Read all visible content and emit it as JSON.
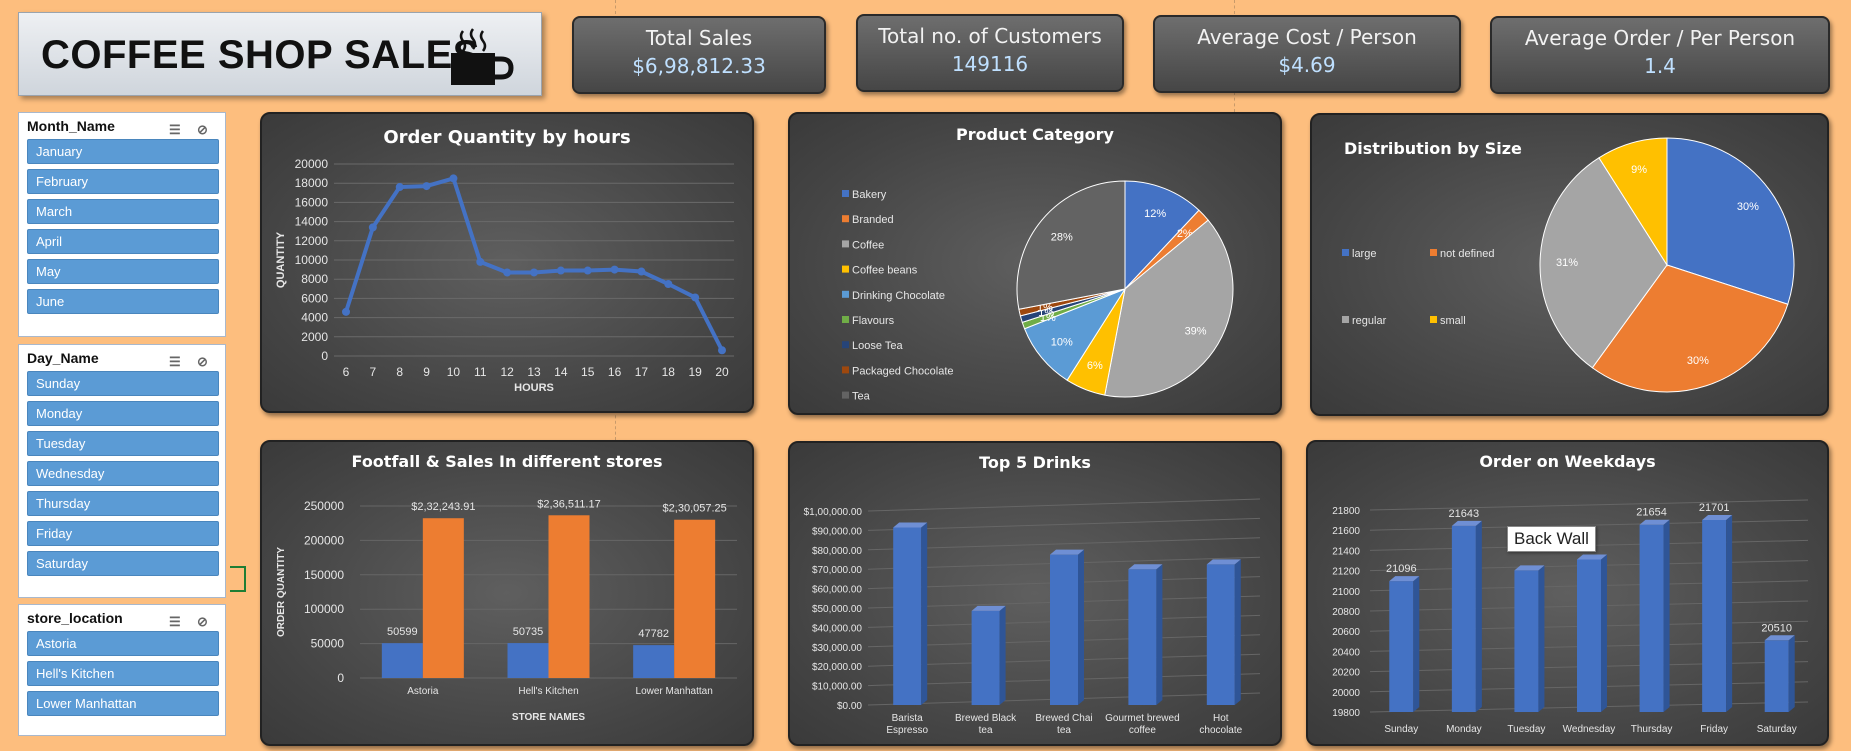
{
  "title": "COFFEE SHOP SALES",
  "kpis": [
    {
      "label": "Total Sales",
      "value": "$6,98,812.33"
    },
    {
      "label": "Total no. of Customers",
      "value": "149116"
    },
    {
      "label": "Average Cost / Person",
      "value": "$4.69"
    },
    {
      "label": "Average Order / Per Person",
      "value": "1.4"
    }
  ],
  "slicers": [
    {
      "title": "Month_Name",
      "items": [
        "January",
        "February",
        "March",
        "April",
        "May",
        "June"
      ]
    },
    {
      "title": "Day_Name",
      "items": [
        "Sunday",
        "Monday",
        "Tuesday",
        "Wednesday",
        "Thursday",
        "Friday",
        "Saturday"
      ]
    },
    {
      "title": "store_location",
      "items": [
        "Astoria",
        "Hell's Kitchen",
        "Lower Manhattan"
      ]
    }
  ],
  "tooltip": "Back Wall",
  "colors": {
    "page_bg": "#FDBE7E",
    "blue": "#4472C4",
    "orange": "#ED7D31",
    "gray": "#A5A5A5",
    "yellow": "#FFC000",
    "lightblue": "#5B9BD5",
    "green": "#70AD47",
    "navy": "#264478",
    "brown": "#9E480E",
    "darkgray": "#636363",
    "slicer_item": "#5B9BD5"
  },
  "chart_data": [
    {
      "id": "hours",
      "type": "line",
      "title": "Order Quantity by hours",
      "xlabel": "HOURS",
      "ylabel": "QUANTITY",
      "x": [
        6,
        7,
        8,
        9,
        10,
        11,
        12,
        13,
        14,
        15,
        16,
        17,
        18,
        19,
        20
      ],
      "values": [
        4600,
        13400,
        17600,
        17700,
        18500,
        9800,
        8700,
        8700,
        8900,
        8900,
        9000,
        8800,
        7500,
        6100,
        600
      ],
      "ylim": [
        0,
        20000
      ],
      "yticks": [
        0,
        2000,
        4000,
        6000,
        8000,
        10000,
        12000,
        14000,
        16000,
        18000,
        20000
      ],
      "grid": true
    },
    {
      "id": "category",
      "type": "pie",
      "title": "Product Category",
      "legend": [
        "Bakery",
        "Branded",
        "Coffee",
        "Coffee beans",
        "Drinking Chocolate",
        "Flavours",
        "Loose Tea",
        "Packaged Chocolate",
        "Tea"
      ],
      "values": [
        12,
        2,
        39,
        6,
        10,
        1,
        1,
        1,
        28
      ],
      "labels": [
        "12%",
        "2%",
        "39%",
        "6%",
        "10%",
        "1%",
        "1%",
        "1%",
        "28%"
      ],
      "colors": [
        "#4472C4",
        "#ED7D31",
        "#A5A5A5",
        "#FFC000",
        "#5B9BD5",
        "#70AD47",
        "#264478",
        "#9E480E",
        "#636363"
      ],
      "legend_position": "left"
    },
    {
      "id": "size",
      "type": "pie",
      "title": "Distribution by Size",
      "legend": [
        "large",
        "not defined",
        "regular",
        "small"
      ],
      "values": [
        30,
        30,
        31,
        9
      ],
      "labels": [
        "30%",
        "30%",
        "31%",
        "9%"
      ],
      "colors": [
        "#4472C4",
        "#ED7D31",
        "#A5A5A5",
        "#FFC000"
      ],
      "legend_position": "left"
    },
    {
      "id": "stores",
      "type": "bar",
      "title": "Footfall & Sales In different stores",
      "xlabel": "STORE NAMES",
      "ylabel": "ORDER QUANTITY",
      "categories": [
        "Astoria",
        "Hell's Kitchen",
        "Lower Manhattan"
      ],
      "series": [
        {
          "values": [
            50599,
            50735,
            47782
          ],
          "labels": [
            "50599",
            "50735",
            "47782"
          ]
        },
        {
          "values": [
            232243.91,
            236511.17,
            230057.25
          ],
          "labels": [
            "$2,32,243.91",
            "$2,36,511.17",
            "$2,30,057.25"
          ]
        }
      ],
      "ylim": [
        0,
        250000
      ],
      "yticks": [
        0,
        50000,
        100000,
        150000,
        200000,
        250000
      ],
      "grid": true
    },
    {
      "id": "drinks",
      "type": "bar",
      "title": "Top 5 Drinks",
      "categories": [
        "Barista Espresso",
        "Brewed Black tea",
        "Brewed Chai tea",
        "Gourmet brewed coffee",
        "Hot chocolate"
      ],
      "values": [
        91500,
        48500,
        77500,
        70000,
        72500
      ],
      "ylim": [
        0,
        100000
      ],
      "yticks": [
        "$0.00",
        "$10,000.00",
        "$20,000.00",
        "$30,000.00",
        "$40,000.00",
        "$50,000.00",
        "$60,000.00",
        "$70,000.00",
        "$80,000.00",
        "$90,000.00",
        "$1,00,000.00"
      ],
      "grid": true
    },
    {
      "id": "weekdays",
      "type": "bar",
      "title": "Order on Weekdays",
      "categories": [
        "Sunday",
        "Monday",
        "Tuesday",
        "Wednesday",
        "Thursday",
        "Friday",
        "Saturday"
      ],
      "values": [
        21096,
        21643,
        21202,
        21310,
        21654,
        21701,
        20510
      ],
      "labels": [
        "21096",
        "21643",
        "",
        "",
        "21654",
        "21701",
        "20510"
      ],
      "ylim": [
        19800,
        21800
      ],
      "yticks": [
        19800,
        20000,
        20200,
        20400,
        20600,
        20800,
        21000,
        21200,
        21400,
        21600,
        21800
      ],
      "grid": true
    }
  ]
}
